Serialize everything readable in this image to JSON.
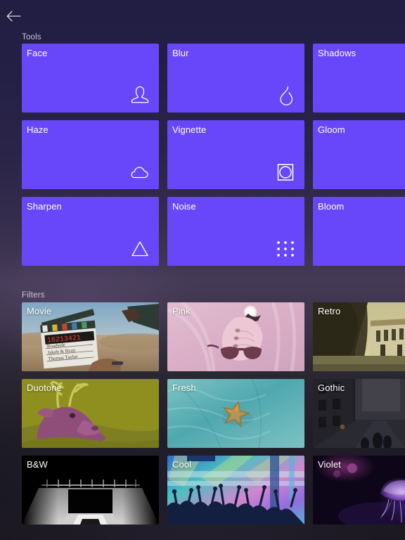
{
  "app": {
    "background_top": "#241f45",
    "background_mid": "#443a55",
    "background_bottom": "#17161d",
    "tile_color": "#6847fa",
    "label_color": "#ffffff"
  },
  "topbar": {
    "back_label": "Back",
    "back_icon": "arrow-left-icon"
  },
  "tools": {
    "heading": "Tools",
    "items": [
      {
        "label": "Face",
        "icon": "portrait-icon"
      },
      {
        "label": "Blur",
        "icon": "water-drop-icon"
      },
      {
        "label": "Shadows",
        "icon": ""
      },
      {
        "label": "Haze",
        "icon": "cloud-icon"
      },
      {
        "label": "Vignette",
        "icon": "circle-in-square-icon"
      },
      {
        "label": "Gloom",
        "icon": ""
      },
      {
        "label": "Sharpen",
        "icon": "triangle-icon"
      },
      {
        "label": "Noise",
        "icon": "dot-grid-icon"
      },
      {
        "label": "Bloom",
        "icon": ""
      }
    ]
  },
  "filters": {
    "heading": "Filters",
    "items": [
      {
        "label": "Movie",
        "thumb": "clapperboard-desert-photo"
      },
      {
        "label": "Pink",
        "thumb": "pink-hands-sunglasses-photo"
      },
      {
        "label": "Retro",
        "thumb": "old-village-street-photo"
      },
      {
        "label": "Duotone",
        "thumb": "olive-magenta-deer-photo"
      },
      {
        "label": "Fresh",
        "thumb": "starfish-teal-water-photo"
      },
      {
        "label": "Gothic",
        "thumb": "dark-city-street-photo"
      },
      {
        "label": "B&W",
        "thumb": "monochrome-underpass-photo"
      },
      {
        "label": "Cool",
        "thumb": "concert-crowd-neon-photo"
      },
      {
        "label": "Violet",
        "thumb": "purple-jellyfish-photo"
      }
    ]
  }
}
